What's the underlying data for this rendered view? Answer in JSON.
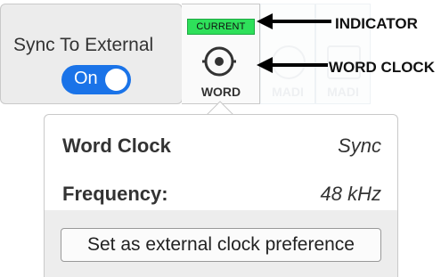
{
  "sync": {
    "label": "Sync To External",
    "toggle_label": "On",
    "toggle_color": "#1a73e8"
  },
  "clock_source": {
    "badge": "Current",
    "badge_color": "#2ee05a",
    "label": "WORD",
    "icon": "word-clock-icon"
  },
  "ghost_sources": [
    {
      "label": "MADI",
      "icon": "madi-icon"
    },
    {
      "label": "MADI",
      "icon": "madi-icon"
    }
  ],
  "popup": {
    "rows": [
      {
        "key": "Word Clock",
        "value": "Sync"
      },
      {
        "key": "Frequency:",
        "value": "48 kHz"
      }
    ],
    "button_label": "Set as external clock preference"
  },
  "annotations": {
    "indicator": "INDICATOR",
    "word_clock": "WORD CLOCK"
  }
}
